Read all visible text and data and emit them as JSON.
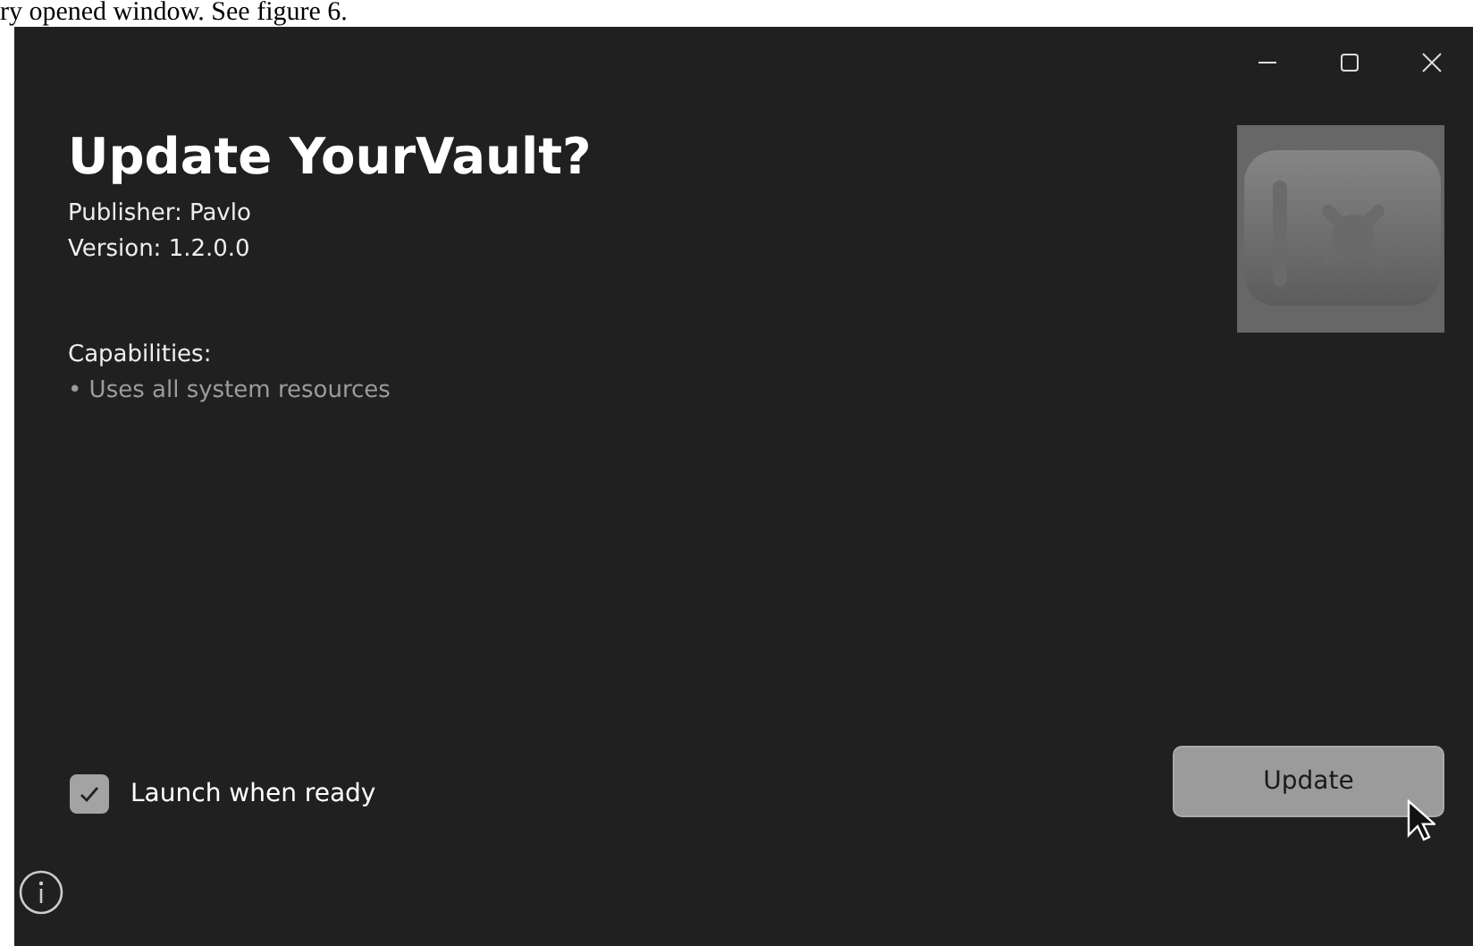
{
  "caption": "ry opened window. See figure 6.",
  "window": {
    "controls": [
      {
        "kind": "minimize"
      },
      {
        "kind": "maximize"
      },
      {
        "kind": "close"
      }
    ]
  },
  "title": "Update YourVault?",
  "publisher": "Publisher: Pavlo",
  "version": "Version: 1.2.0.0",
  "capabilities": {
    "heading": "Capabilities:",
    "items": [
      "• Uses all system resources"
    ]
  },
  "launch_checkbox": {
    "label": "Launch when ready",
    "checked": true
  },
  "update_button": {
    "label": "Update"
  }
}
